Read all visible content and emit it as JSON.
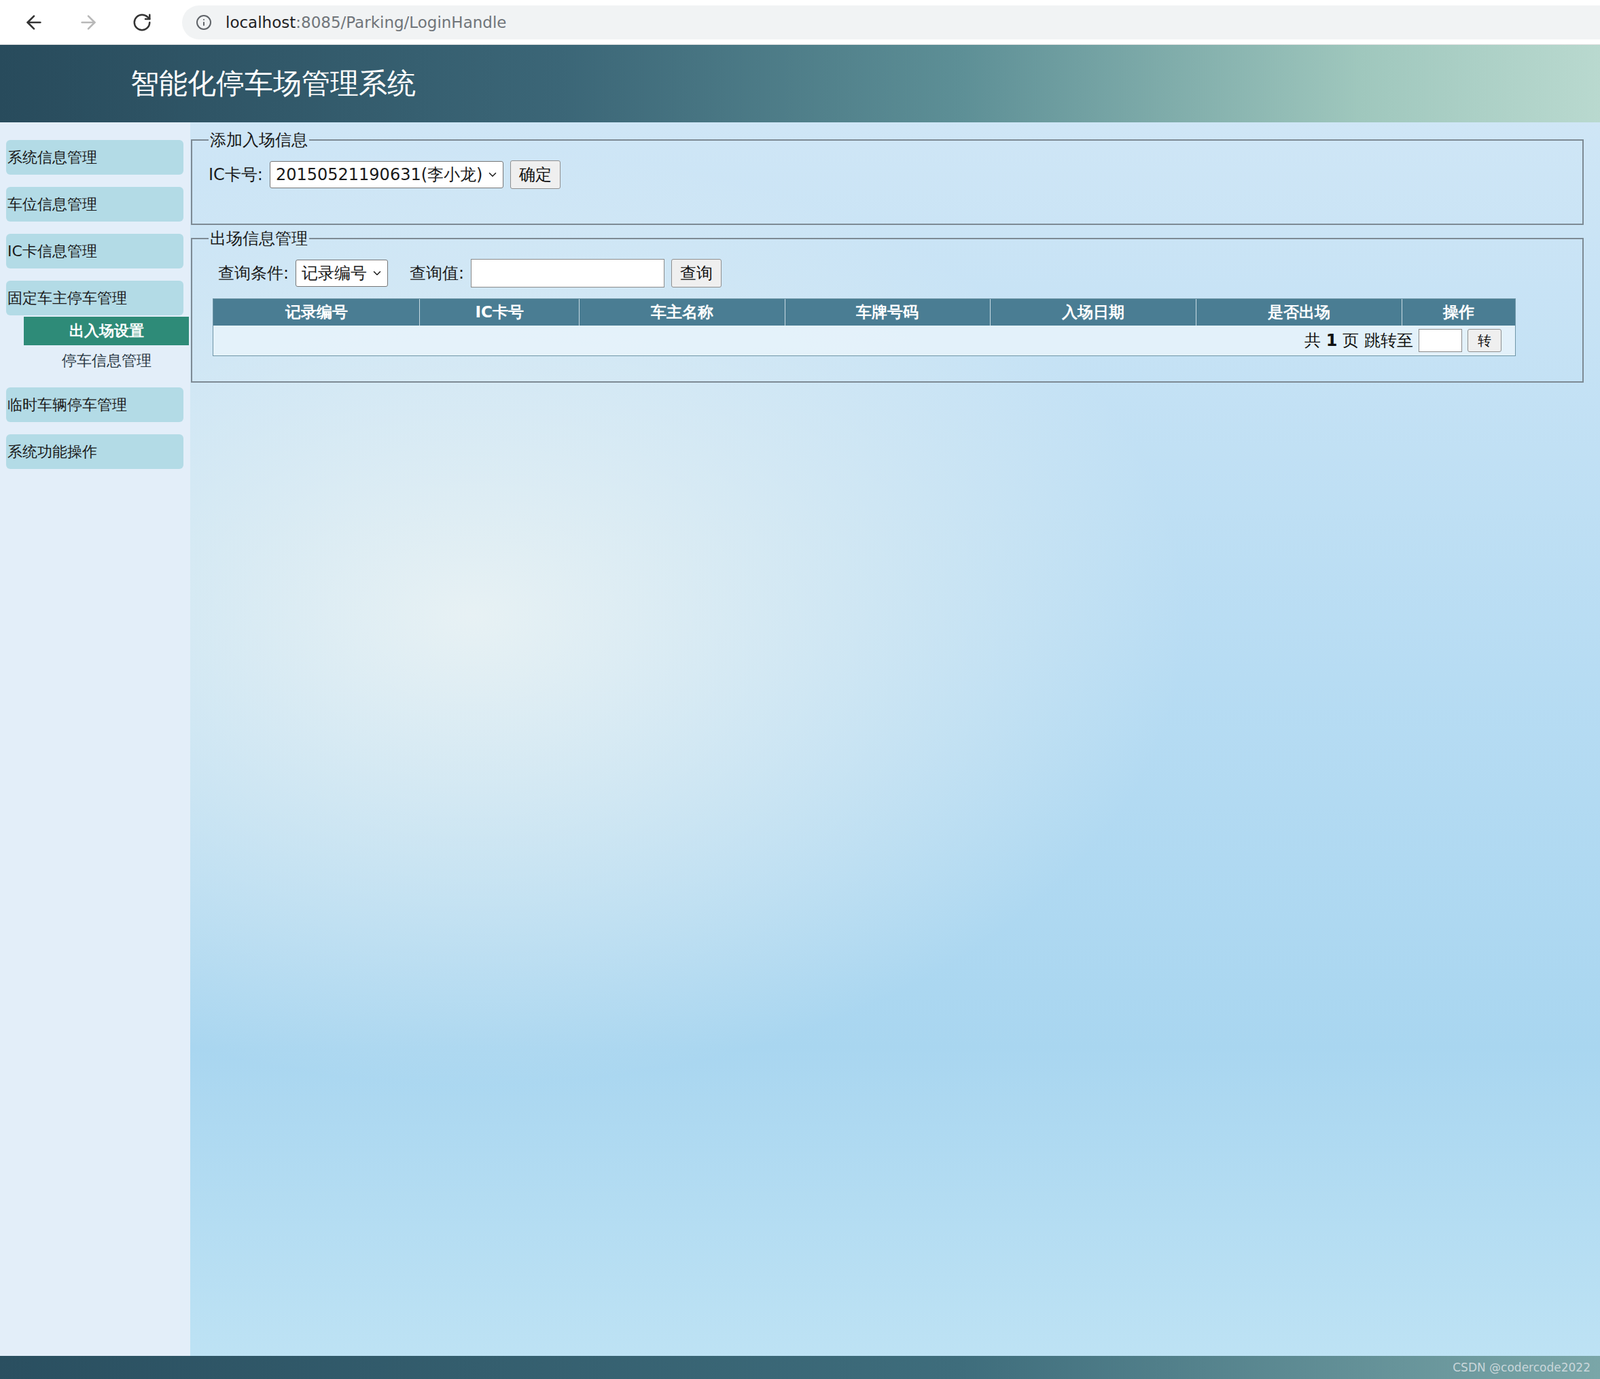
{
  "browser": {
    "url_host": "localhost",
    "url_rest": ":8085/Parking/LoginHandle",
    "back_disabled": false,
    "forward_disabled": true
  },
  "header": {
    "title": "智能化停车场管理系统"
  },
  "sidebar": {
    "items": [
      {
        "label": "系统信息管理",
        "selected": false,
        "children": []
      },
      {
        "label": "车位信息管理",
        "selected": false,
        "children": []
      },
      {
        "label": "IC卡信息管理",
        "selected": false,
        "children": []
      },
      {
        "label": "固定车主停车管理",
        "selected": false,
        "children": [
          {
            "label": "出入场设置",
            "selected": true
          },
          {
            "label": "停车信息管理",
            "selected": false
          }
        ]
      },
      {
        "label": "临时车辆停车管理",
        "selected": false,
        "children": []
      },
      {
        "label": "系统功能操作",
        "selected": false,
        "children": []
      }
    ]
  },
  "entry_form": {
    "legend": "添加入场信息",
    "label": "IC卡号:",
    "value": "20150521190631(李小龙)",
    "button": "确定"
  },
  "exit_panel": {
    "legend": "出场信息管理",
    "query": {
      "condition_label": "查询条件:",
      "condition_value": "记录编号",
      "value_label": "查询值:",
      "value": "",
      "button": "查询"
    },
    "table": {
      "columns": [
        "记录编号",
        "IC卡号",
        "车主名称",
        "车牌号码",
        "入场日期",
        "是否出场",
        "操作"
      ],
      "rows": []
    },
    "pager": {
      "prefix": "共",
      "pages": "1",
      "suffix": "页 跳转至",
      "page_input": "",
      "button": "转"
    }
  },
  "footer": {
    "watermark": "CSDN @codercode2022"
  }
}
